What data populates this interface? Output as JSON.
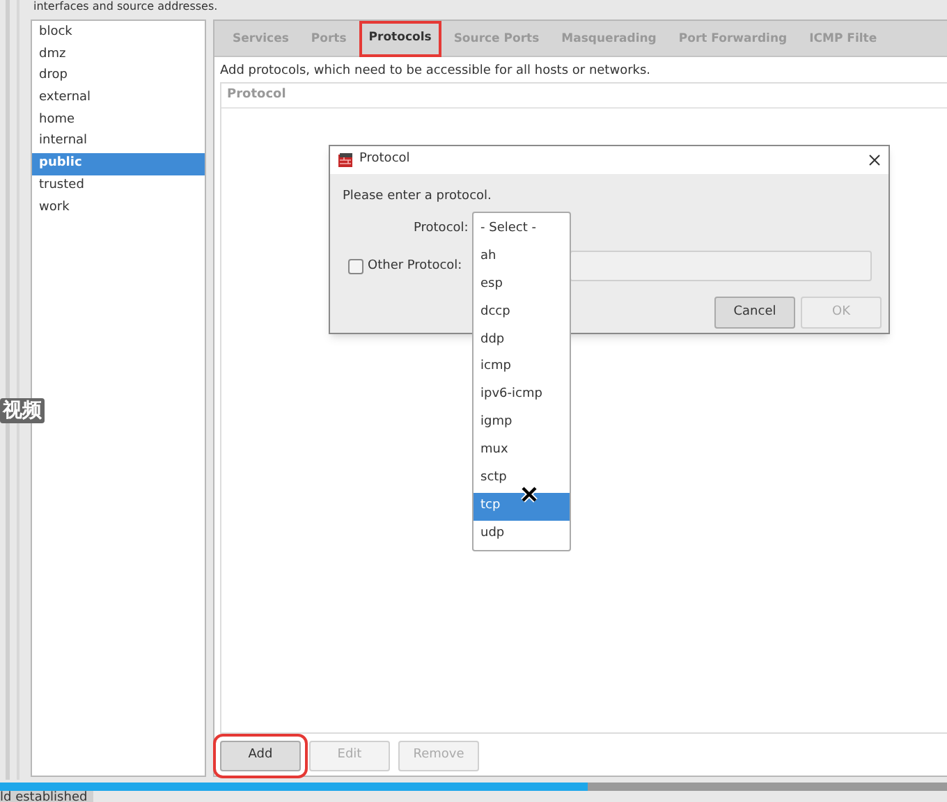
{
  "page_text": "interfaces and source addresses.",
  "zones": [
    {
      "label": "block",
      "selected": false
    },
    {
      "label": "dmz",
      "selected": false
    },
    {
      "label": "drop",
      "selected": false
    },
    {
      "label": "external",
      "selected": false
    },
    {
      "label": "home",
      "selected": false
    },
    {
      "label": "internal",
      "selected": false
    },
    {
      "label": "public",
      "selected": true
    },
    {
      "label": "trusted",
      "selected": false
    },
    {
      "label": "work",
      "selected": false
    }
  ],
  "tabs": [
    {
      "label": "Services",
      "selected": false,
      "highlighted": false
    },
    {
      "label": "Ports",
      "selected": false,
      "highlighted": false
    },
    {
      "label": "Protocols",
      "selected": true,
      "highlighted": true
    },
    {
      "label": "Source Ports",
      "selected": false,
      "highlighted": false
    },
    {
      "label": "Masquerading",
      "selected": false,
      "highlighted": false
    },
    {
      "label": "Port Forwarding",
      "selected": false,
      "highlighted": false
    },
    {
      "label": "ICMP Filte",
      "selected": false,
      "highlighted": false
    }
  ],
  "description": "Add protocols, which need to be accessible for all hosts or networks.",
  "table": {
    "columns": [
      "Protocol"
    ]
  },
  "buttons": [
    {
      "label": "Add",
      "disabled": false,
      "highlighted": true
    },
    {
      "label": "Edit",
      "disabled": true,
      "highlighted": false
    },
    {
      "label": "Remove",
      "disabled": true,
      "highlighted": false
    }
  ],
  "dialog": {
    "title": "Protocol",
    "prompt": "Please enter a protocol.",
    "protocol_label": "Protocol:",
    "other_protocol": {
      "label": "Other Protocol:",
      "checked": false
    },
    "buttons": [
      {
        "label": "Cancel",
        "disabled": false
      },
      {
        "label": "OK",
        "disabled": true
      }
    ]
  },
  "dropdown": {
    "options": [
      {
        "label": "- Select -",
        "selected": false
      },
      {
        "label": "ah",
        "selected": false
      },
      {
        "label": "esp",
        "selected": false
      },
      {
        "label": "dccp",
        "selected": false
      },
      {
        "label": "ddp",
        "selected": false
      },
      {
        "label": "icmp",
        "selected": false
      },
      {
        "label": "ipv6-icmp",
        "selected": false
      },
      {
        "label": "igmp",
        "selected": false
      },
      {
        "label": "mux",
        "selected": false
      },
      {
        "label": "sctp",
        "selected": false
      },
      {
        "label": "tcp",
        "selected": true
      },
      {
        "label": "udp",
        "selected": false
      }
    ]
  },
  "video_overlay": {
    "caption": "视频",
    "status": "ld established",
    "progress": {
      "level": 0.62
    }
  }
}
